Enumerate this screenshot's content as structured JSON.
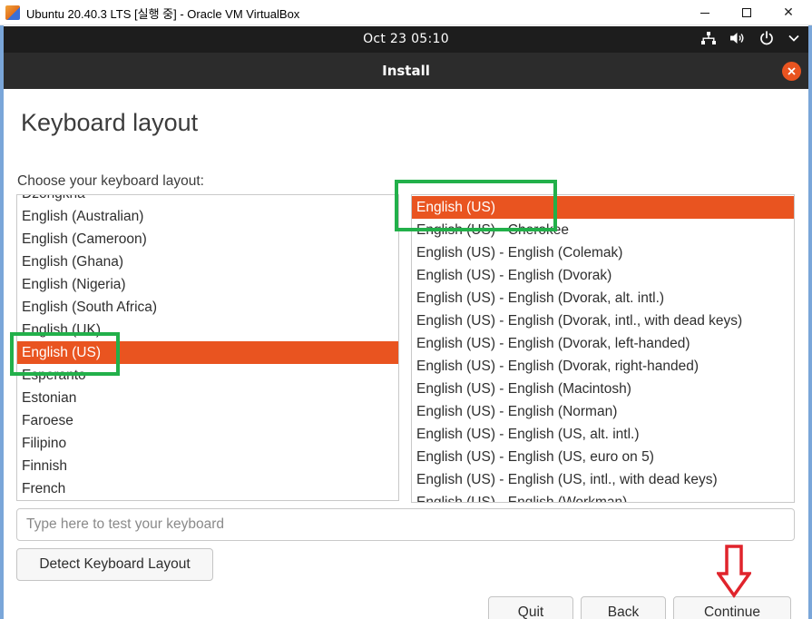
{
  "host_window": {
    "title": "Ubuntu 20.40.3 LTS [실행 중] - Oracle VM VirtualBox",
    "minimize_label": "",
    "maximize_label": "",
    "close_label": "✕"
  },
  "topbar": {
    "clock": "Oct 23  05:10",
    "tray_icons": [
      "network-icon",
      "volume-icon",
      "power-icon",
      "chevron-down-icon"
    ]
  },
  "installer": {
    "title": "Install",
    "close_icon": "close-icon"
  },
  "page": {
    "title": "Keyboard layout",
    "section_label": "Choose your keyboard layout:"
  },
  "layouts": {
    "items": [
      "Dzongkha",
      "English (Australian)",
      "English (Cameroon)",
      "English (Ghana)",
      "English (Nigeria)",
      "English (South Africa)",
      "English (UK)",
      "English (US)",
      "Esperanto",
      "Estonian",
      "Faroese",
      "Filipino",
      "Finnish",
      "French"
    ],
    "selected": "English (US)"
  },
  "variants": {
    "items": [
      "English (US)",
      "English (US) - Cherokee",
      "English (US) - English (Colemak)",
      "English (US) - English (Dvorak)",
      "English (US) - English (Dvorak, alt. intl.)",
      "English (US) - English (Dvorak, intl., with dead keys)",
      "English (US) - English (Dvorak, left-handed)",
      "English (US) - English (Dvorak, right-handed)",
      "English (US) - English (Macintosh)",
      "English (US) - English (Norman)",
      "English (US) - English (US, alt. intl.)",
      "English (US) - English (US, euro on 5)",
      "English (US) - English (US, intl., with dead keys)",
      "English (US) - English (Workman)"
    ],
    "selected": "English (US)"
  },
  "test_field": {
    "value": "",
    "placeholder": "Type here to test your keyboard"
  },
  "buttons": {
    "detect": "Detect Keyboard Layout",
    "quit": "Quit",
    "back": "Back",
    "continue": "Continue"
  },
  "colors": {
    "accent": "#e95420",
    "topbar": "#1d1d1d",
    "header": "#2c2c2c",
    "highlight": "#22b04a",
    "arrow": "#e0242c"
  }
}
